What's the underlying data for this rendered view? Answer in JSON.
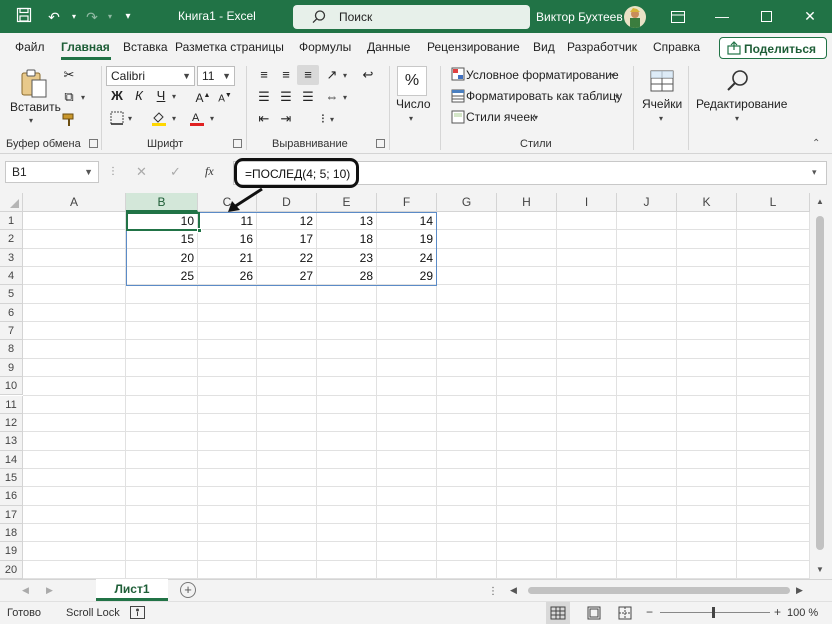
{
  "titlebar": {
    "title": "Книга1  -  Excel",
    "search_placeholder": "Поиск",
    "user_name": "Виктор Бухтеев"
  },
  "tabs": [
    {
      "label": "Файл",
      "active": false
    },
    {
      "label": "Главная",
      "active": true
    },
    {
      "label": "Вставка",
      "active": false
    },
    {
      "label": "Разметка страницы",
      "active": false
    },
    {
      "label": "Формулы",
      "active": false
    },
    {
      "label": "Данные",
      "active": false
    },
    {
      "label": "Рецензирование",
      "active": false
    },
    {
      "label": "Вид",
      "active": false
    },
    {
      "label": "Разработчик",
      "active": false
    },
    {
      "label": "Справка",
      "active": false
    }
  ],
  "share_label": "Поделиться",
  "ribbon": {
    "clipboard": {
      "group_label": "Буфер обмена",
      "paste_label": "Вставить"
    },
    "font": {
      "group_label": "Шрифт",
      "font_name": "Calibri",
      "font_size": "11",
      "bold": "Ж",
      "italic": "К",
      "underline": "Ч"
    },
    "alignment": {
      "group_label": "Выравнивание"
    },
    "number": {
      "group_label": "",
      "label": "Число"
    },
    "styles": {
      "group_label": "Стили",
      "conditional": "Условное форматирование",
      "as_table": "Форматировать как таблицу",
      "cell_styles": "Стили ячеек"
    },
    "cells": {
      "label": "Ячейки"
    },
    "editing": {
      "label": "Редактирование"
    }
  },
  "formula_bar": {
    "name_box": "B1",
    "fx": "fx",
    "formula": "=ПОСЛЕД(4; 5; 10)"
  },
  "grid": {
    "columns": [
      "A",
      "B",
      "C",
      "D",
      "E",
      "F",
      "G",
      "H",
      "I",
      "J",
      "K",
      "L"
    ],
    "selected_column": "B",
    "rows": [
      "1",
      "2",
      "3",
      "4",
      "5",
      "6",
      "7",
      "8",
      "9",
      "10",
      "11",
      "12",
      "13",
      "14",
      "15",
      "16",
      "17",
      "18",
      "19",
      "20"
    ],
    "values": [
      [
        "10",
        "11",
        "12",
        "13",
        "14"
      ],
      [
        "15",
        "16",
        "17",
        "18",
        "19"
      ],
      [
        "20",
        "21",
        "22",
        "23",
        "24"
      ],
      [
        "25",
        "26",
        "27",
        "28",
        "29"
      ]
    ]
  },
  "sheets": {
    "active": "Лист1"
  },
  "status": {
    "ready": "Готово",
    "scroll_lock": "Scroll Lock",
    "zoom": "100 %"
  },
  "colors": {
    "brand": "#217346",
    "selection": "#5b8bc7"
  }
}
